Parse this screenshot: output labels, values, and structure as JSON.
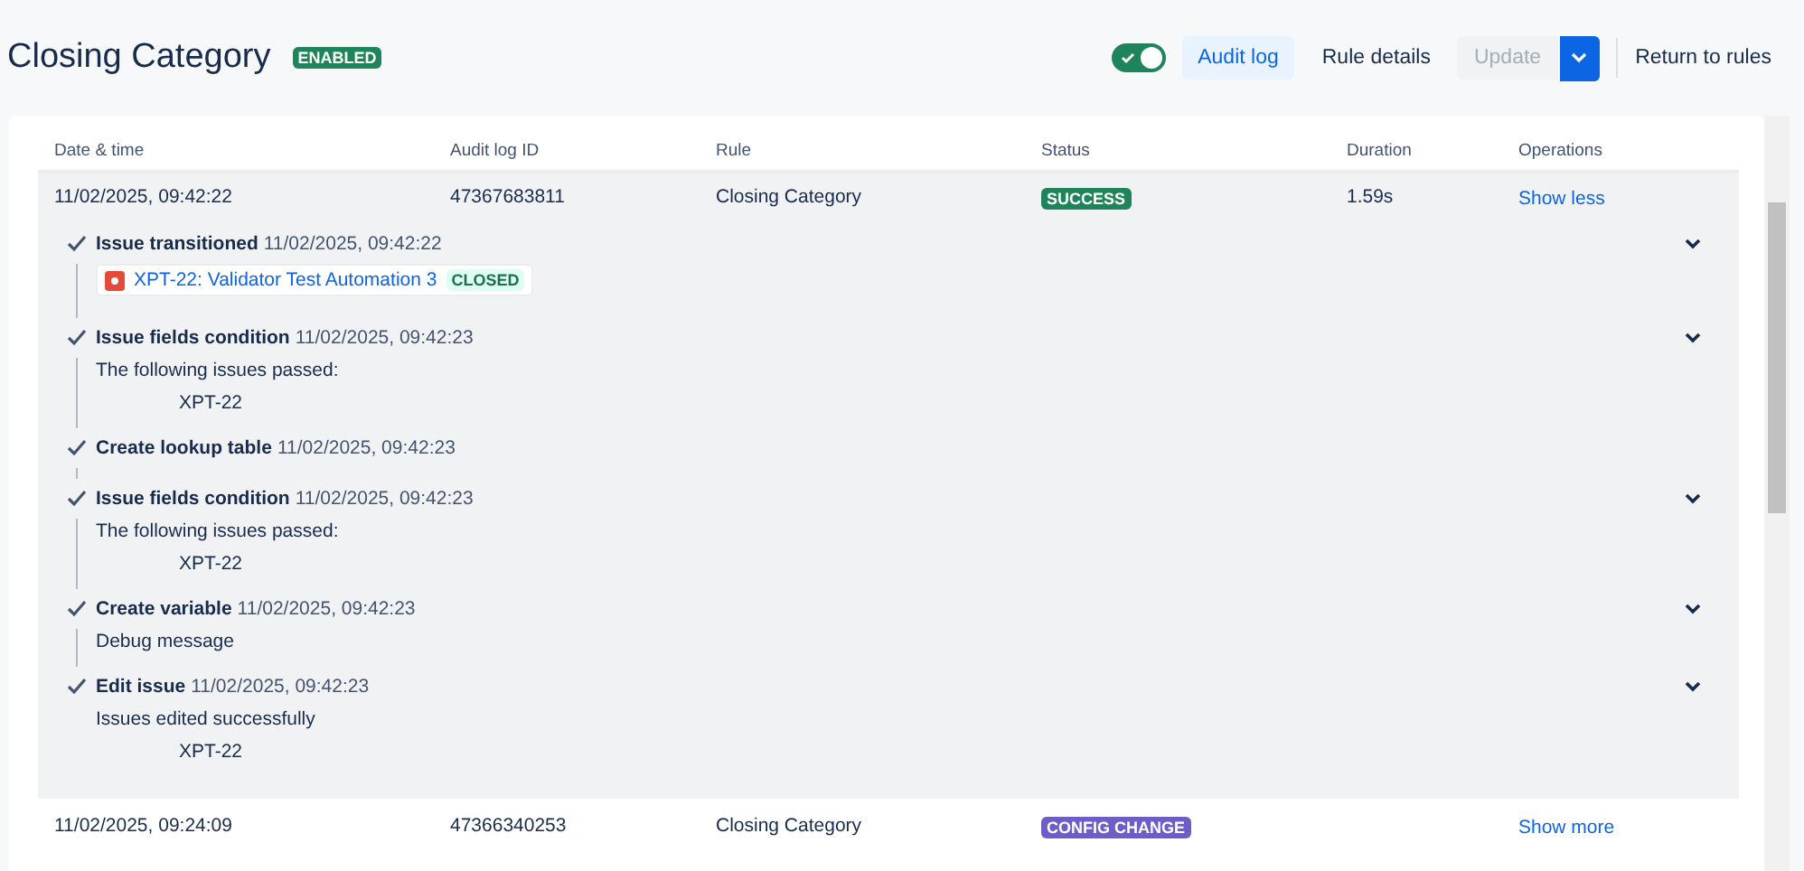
{
  "header": {
    "title": "Closing Category",
    "status_badge": "ENABLED",
    "rule_toggle": {
      "on": true
    },
    "tabs": [
      {
        "label": "Audit log",
        "selected": true
      },
      {
        "label": "Rule details",
        "selected": false
      }
    ],
    "update_button": {
      "label": "Update",
      "disabled": true
    },
    "return_link": "Return to rules"
  },
  "table": {
    "columns": [
      "Date & time",
      "Audit log ID",
      "Rule",
      "Status",
      "Duration",
      "Operations"
    ],
    "rows": [
      {
        "date": "11/02/2025, 09:42:22",
        "id": "47367683811",
        "rule": "Closing Category",
        "status": "SUCCESS",
        "kind": "success",
        "duration": "1.59s",
        "operation": "Show less",
        "expanded": true,
        "steps": [
          {
            "title": "Issue transitioned",
            "time": "11/02/2025, 09:42:22",
            "expandable": true,
            "issue": {
              "label": "XPT-22: Validator Test Automation 3",
              "status": "CLOSED"
            }
          },
          {
            "title": "Issue fields condition",
            "time": "11/02/2025, 09:42:23",
            "expandable": true,
            "message": "The following issues passed:",
            "items": [
              "XPT-22"
            ]
          },
          {
            "title": "Create lookup table",
            "time": "11/02/2025, 09:42:23",
            "expandable": false
          },
          {
            "title": "Issue fields condition",
            "time": "11/02/2025, 09:42:23",
            "expandable": true,
            "message": "The following issues passed:",
            "items": [
              "XPT-22"
            ]
          },
          {
            "title": "Create variable",
            "time": "11/02/2025, 09:42:23",
            "expandable": true,
            "message": "Debug message"
          },
          {
            "title": "Edit issue",
            "time": "11/02/2025, 09:42:23",
            "expandable": true,
            "message": "Issues edited successfully",
            "items": [
              "XPT-22"
            ]
          }
        ]
      },
      {
        "date": "11/02/2025, 09:24:09",
        "id": "47366340253",
        "rule": "Closing Category",
        "status": "CONFIG CHANGE",
        "kind": "config",
        "operation": "Show more",
        "expanded": false
      }
    ]
  }
}
